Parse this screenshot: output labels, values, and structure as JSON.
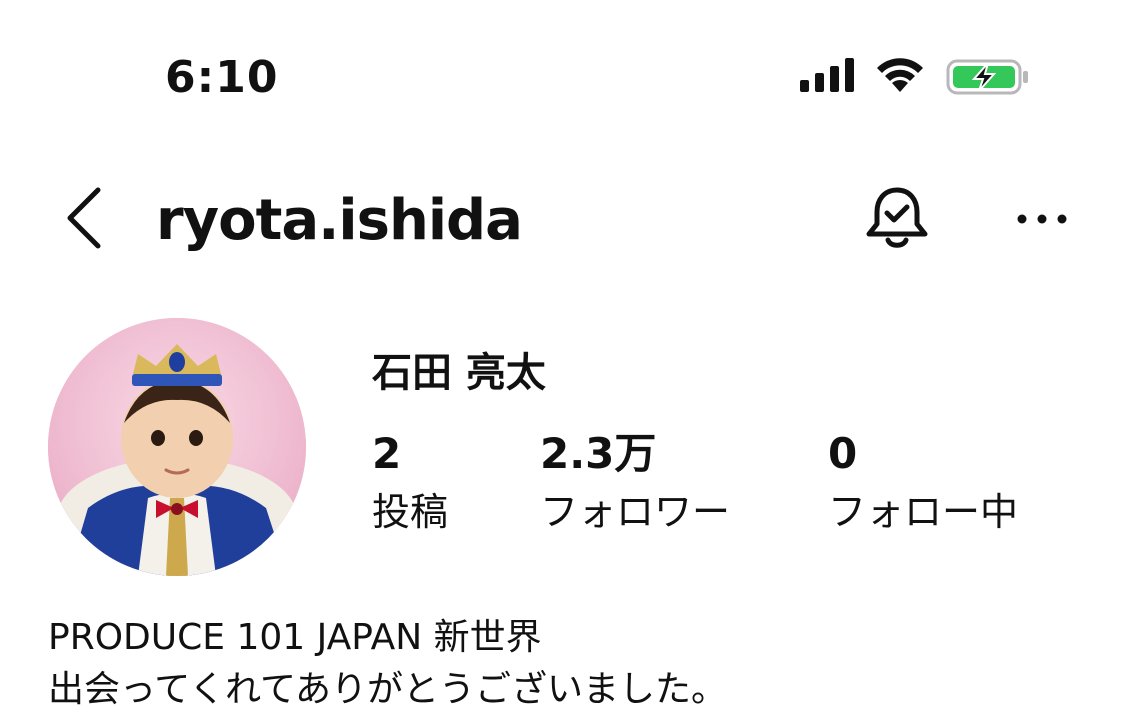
{
  "status_bar": {
    "time": "6:10"
  },
  "header": {
    "username": "ryota.ishida",
    "icons": {
      "back": "chevron-left-icon",
      "notifications": "bell-check-icon",
      "more": "more-horizontal-icon"
    }
  },
  "profile": {
    "display_name": "石田 亮太",
    "stats": [
      {
        "value": "2",
        "label": "投稿"
      },
      {
        "value": "2.3万",
        "label": "フォロワー"
      },
      {
        "value": "0",
        "label": "フォロー中"
      }
    ],
    "bio": [
      "PRODUCE 101 JAPAN 新世界",
      "出会ってくれてありがとうございました。"
    ]
  },
  "colors": {
    "battery_fill": "#34c759",
    "text": "#111111"
  }
}
